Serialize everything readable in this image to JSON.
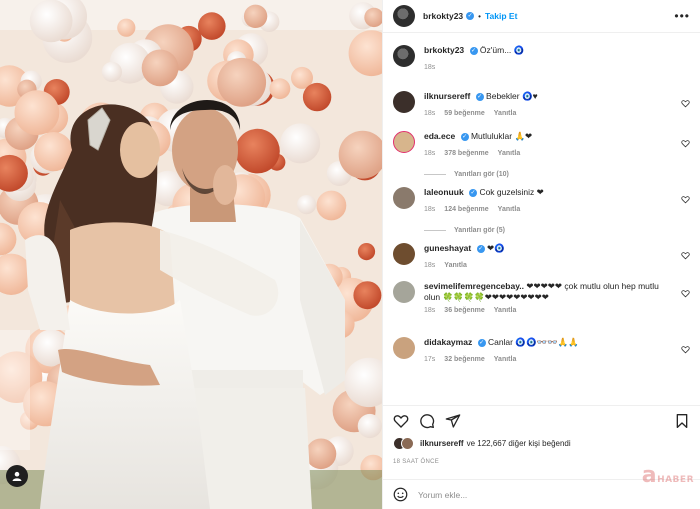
{
  "post": {
    "username": "brkokty23",
    "follow_label": "Takip Et",
    "caption_text": "Öz'üm...",
    "caption_time": "18s",
    "likes_user": "ilknursereff",
    "likes_text": "ve 122,667 diğer kişi beğendi",
    "posted_ago": "18 SAAT ÖNCE",
    "comment_placeholder": "Yorum ekle..."
  },
  "comments": [
    {
      "user": "ilknursereff",
      "text": "Bebekler",
      "emoji": "🧿♥",
      "time": "18s",
      "likes": "59 beğenme",
      "reply": "Yanıtla",
      "avatar_color": "#3b2f2a"
    },
    {
      "user": "eda.ece",
      "text": "Mutluluklar",
      "emoji": "🙏❤",
      "time": "18s",
      "likes": "378 beğenme",
      "reply": "Yanıtla",
      "avatar_color": "#d7b58c",
      "replies": "Yanıtları gör (10)"
    },
    {
      "user": "laleonuuk",
      "text": "Cok guzelsiniz",
      "emoji": "❤",
      "time": "18s",
      "likes": "124 beğenme",
      "reply": "Yanıtla",
      "avatar_color": "#8a7a6c",
      "replies": "Yanıtları gör (5)"
    },
    {
      "user": "guneshayat",
      "text": "",
      "emoji": "❤🧿",
      "time": "18s",
      "likes": "",
      "reply": "Yanıtla",
      "avatar_color": "#6e4d2f"
    },
    {
      "user": "sevimelifemregencebay..",
      "text": "",
      "emoji": "❤❤❤❤❤",
      "text2": "çok mutlu olun hep mutlu olun",
      "emoji2": "🍀🍀🍀🍀❤❤❤❤❤❤❤❤❤",
      "time": "18s",
      "likes": "36 beğenme",
      "reply": "Yanıtla",
      "avatar_color": "#a5a59a"
    },
    {
      "user": "didakaymaz",
      "text": "Canlar",
      "emoji": "🧿🧿👓👓🙏🙏",
      "time": "17s",
      "likes": "32 beğenme",
      "reply": "Yanıtla",
      "avatar_color": "#c9a27e"
    }
  ],
  "icons": [
    "more-icon",
    "heart-icon",
    "comment-icon",
    "share-icon",
    "bookmark-icon",
    "emoji-icon",
    "verified-icon"
  ],
  "colors": {
    "link": "#0095f6",
    "verified": "#3897f0",
    "heart": "#ed4956",
    "muted": "#8e8e8e"
  }
}
